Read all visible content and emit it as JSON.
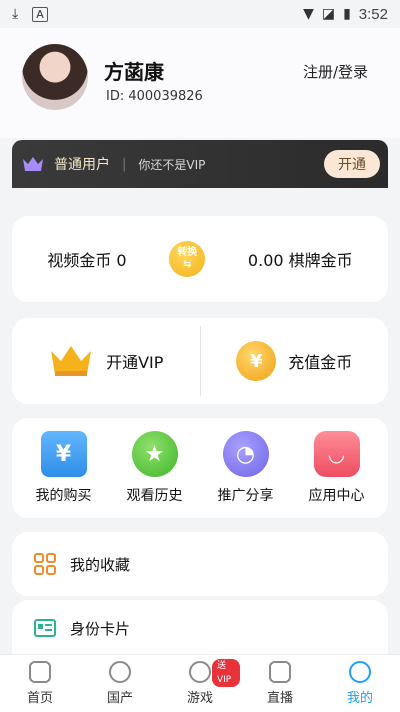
{
  "status": {
    "time": "3:52"
  },
  "profile": {
    "name": "方菡康",
    "id_text": "ID: 400039826",
    "login_label": "注册/登录"
  },
  "vip_banner": {
    "level": "普通用户",
    "note": "你还不是VIP",
    "button": "开通"
  },
  "wallet": {
    "video_coins": "视频金币 0",
    "exchange_label": "转换",
    "chess_coins": "0.00 棋牌金币"
  },
  "actions": {
    "vip": "开通VIP",
    "recharge": "充值金币",
    "coin_symbol": "¥"
  },
  "grid": [
    {
      "label": "我的购买",
      "icon": "cart-yen-icon",
      "glyph": "¥"
    },
    {
      "label": "观看历史",
      "icon": "star-icon",
      "glyph": "★"
    },
    {
      "label": "推广分享",
      "icon": "clock-icon",
      "glyph": "◔"
    },
    {
      "label": "应用中心",
      "icon": "gift-bag-icon",
      "glyph": "◡"
    }
  ],
  "list": {
    "collect": "我的收藏",
    "idcard": "身份卡片"
  },
  "tabs": [
    {
      "label": "首页",
      "icon": "home-icon"
    },
    {
      "label": "国产",
      "icon": "flame-icon"
    },
    {
      "label": "游戏",
      "icon": "game-icon",
      "badge": "送VIP"
    },
    {
      "label": "直播",
      "icon": "live-icon"
    },
    {
      "label": "我的",
      "icon": "profile-icon",
      "active": true
    }
  ],
  "colors": {
    "accent": "#1aa3f5",
    "vip_bar": "#2e2e2e"
  }
}
